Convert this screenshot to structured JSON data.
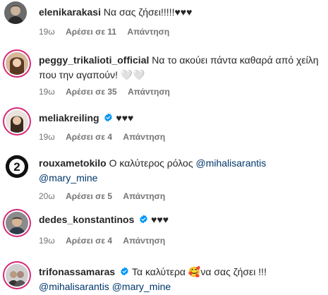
{
  "comments": [
    {
      "username": "elenikarakasi",
      "verified": false,
      "body": "Να σας ζήσει!!!!!♥♥♥",
      "time": "19ω",
      "likes": "Αρέσει σε 11",
      "reply": "Απάντηση"
    },
    {
      "username": "peggy_trikalioti_official",
      "verified": false,
      "body": "Να το ακούει πάντα καθαρά από χείλη που την αγαπούν! 🤍🤍",
      "time": "19ω",
      "likes": "Αρέσει σε 35",
      "reply": "Απάντηση"
    },
    {
      "username": "meliakreiling",
      "verified": true,
      "body": "♥♥♥",
      "time": "19ω",
      "likes": "Αρέσει σε 4",
      "reply": "Απάντηση"
    },
    {
      "username": "rouxametokilo",
      "verified": false,
      "body": "Ο καλύτερος ρόλος",
      "mention1": "@mihalisarantis",
      "mention2": "@mary_mine",
      "time": "20ω",
      "likes": "Αρέσει σε 5",
      "reply": "Απάντηση"
    },
    {
      "username": "dedes_konstantinos",
      "verified": true,
      "body": "♥♥♥",
      "time": "19ω",
      "likes": "Αρέσει σε 4",
      "reply": "Απάντηση"
    },
    {
      "username": "trifonassamaras",
      "verified": true,
      "body": "Τα καλύτερα 🥰να σας ζήσει !!!",
      "mention1": "@mihalisarantis",
      "mention2": "@mary_mine"
    }
  ],
  "colors": {
    "text": "#262626",
    "meta": "#737373",
    "mention": "#00376b",
    "verified": "#0095f6",
    "story_ring": "#d62976"
  },
  "icons": {
    "verified": "verified-badge-icon"
  }
}
